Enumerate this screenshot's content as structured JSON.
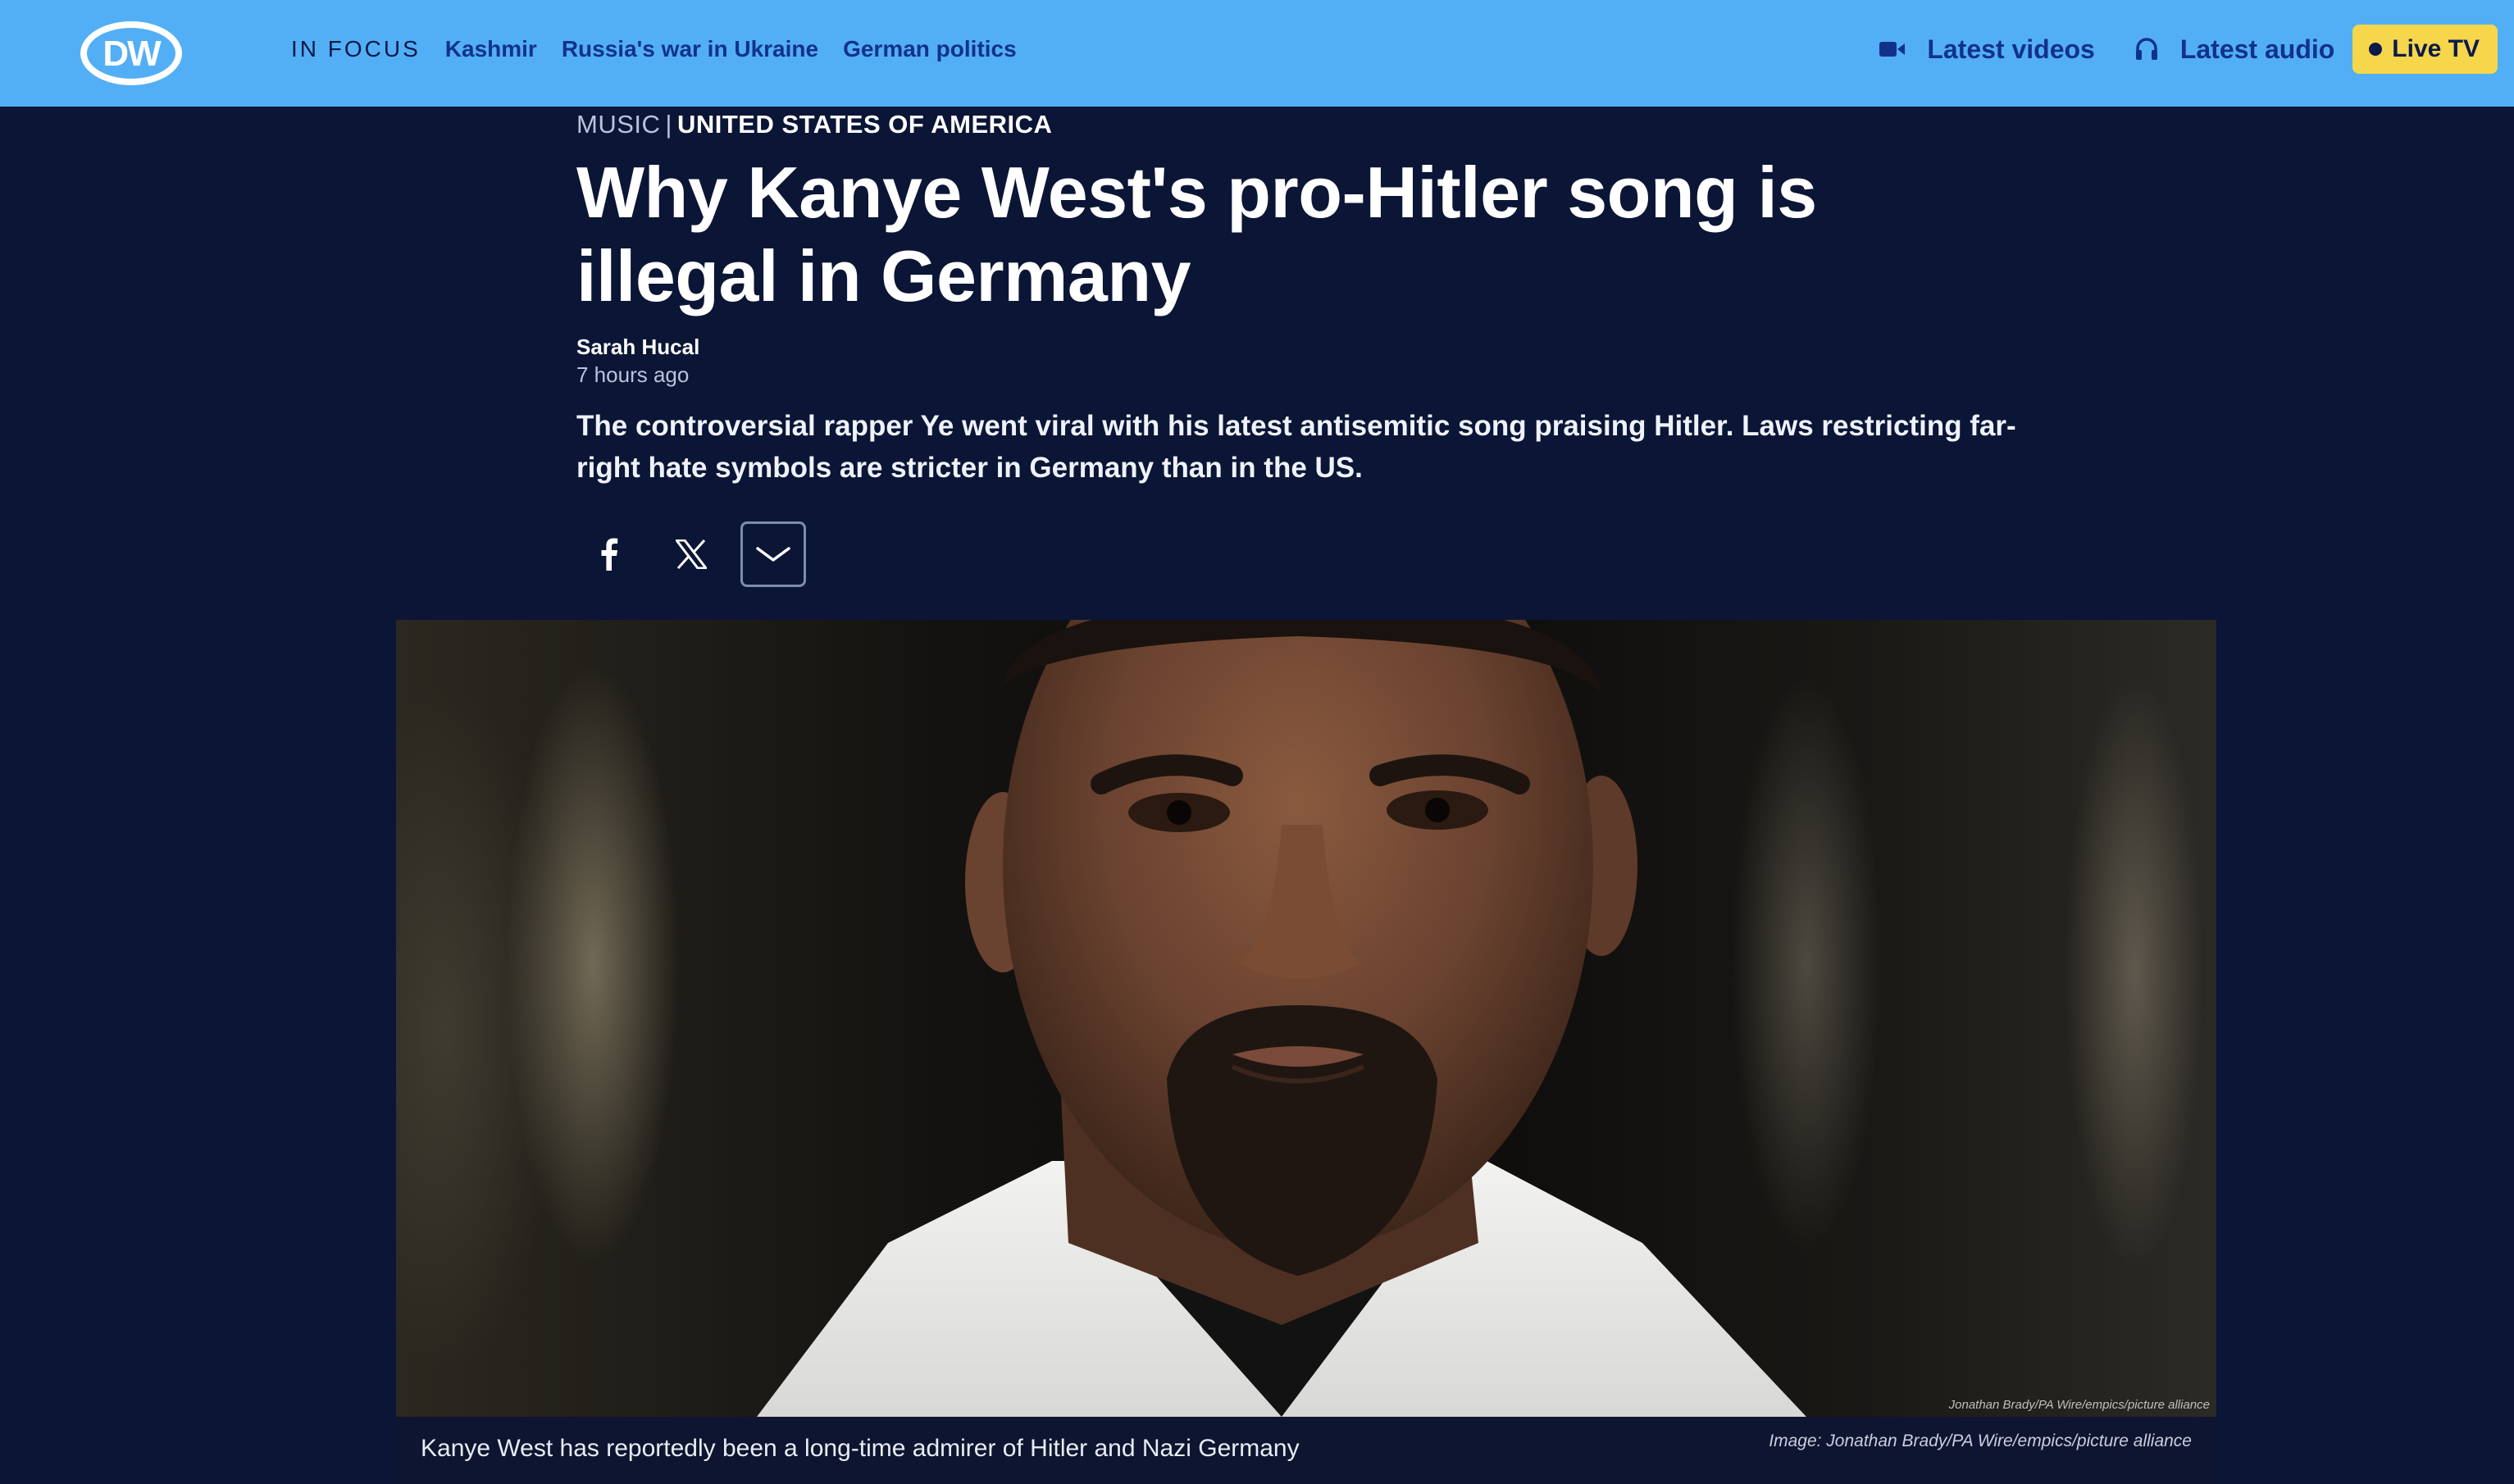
{
  "header": {
    "logo_text": "DW",
    "in_focus_label": "IN FOCUS",
    "topics": [
      "Kashmir",
      "Russia's war in Ukraine",
      "German politics"
    ],
    "latest_videos": "Latest videos",
    "latest_audio": "Latest audio",
    "live_tv": "Live TV"
  },
  "article": {
    "category": "MUSIC",
    "separator": "|",
    "region": "UNITED STATES OF AMERICA",
    "headline": "Why Kanye West's pro-Hitler song is illegal in Germany",
    "author": "Sarah Hucal",
    "published": "7 hours ago",
    "teaser": "The controversial rapper Ye went viral with his latest antisemitic song praising Hitler. Laws restricting far-right hate symbols are stricter in Germany than in the US."
  },
  "share": {
    "icons": [
      "facebook-icon",
      "x-icon",
      "chevron-down-icon"
    ]
  },
  "image": {
    "overlay_credit": "Jonathan Brady/PA Wire/empics/picture alliance",
    "caption": "Kanye West has reportedly been a long-time admirer of Hitler and Nazi Germany",
    "credit": "Image: Jonathan Brady/PA Wire/empics/picture alliance"
  },
  "colors": {
    "header_bg": "#52aff5",
    "page_bg": "#0b1535",
    "nav_link": "#12328a",
    "live_tv_bg": "#f6d64a"
  }
}
